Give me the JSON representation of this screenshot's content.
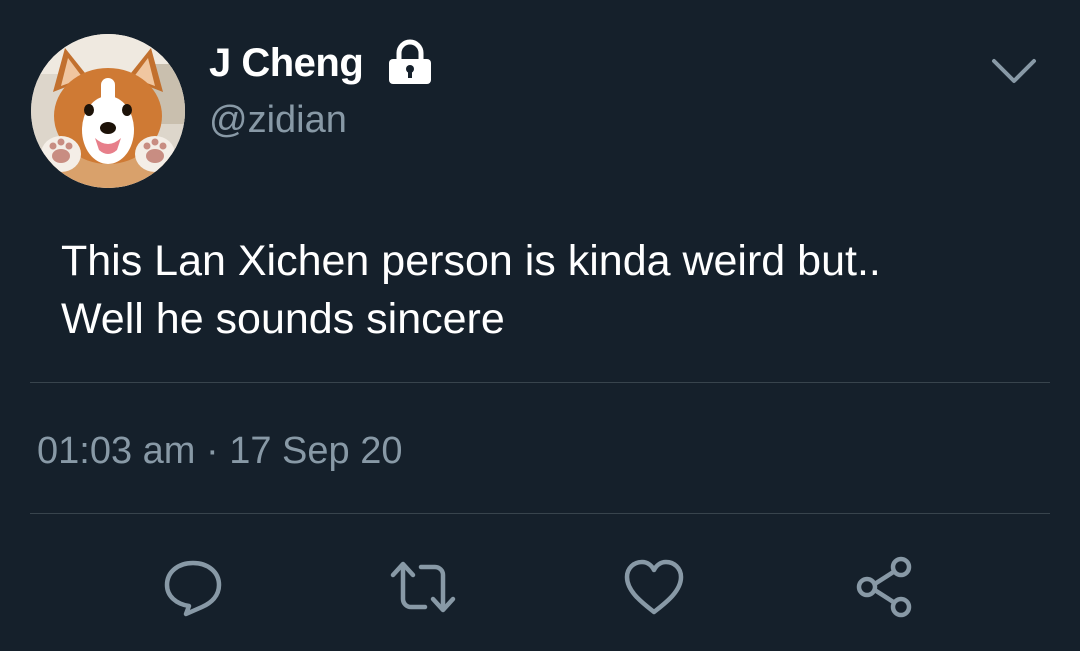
{
  "user": {
    "display_name": "J Cheng",
    "handle": "@zidian",
    "protected": true,
    "avatar_icon": "corgi-photo"
  },
  "tweet": {
    "text_lines": [
      "This Lan Xichen person is kinda weird but..",
      "Well he sounds sincere"
    ],
    "timestamp": "01:03 am · 17 Sep 20"
  },
  "actions": [
    {
      "icon": "reply-icon"
    },
    {
      "icon": "retweet-icon"
    },
    {
      "icon": "like-icon"
    },
    {
      "icon": "share-icon"
    }
  ],
  "colors": {
    "background": "#15202b",
    "secondary_text": "#8899a6",
    "divider": "#38444d",
    "primary_text": "#ffffff"
  }
}
